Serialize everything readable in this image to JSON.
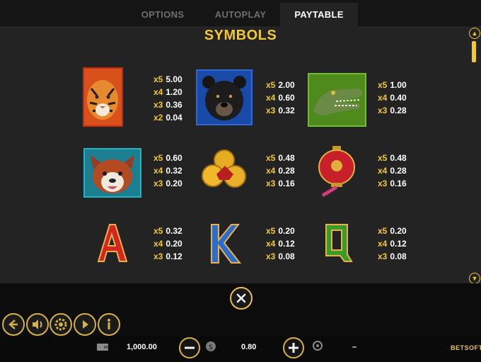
{
  "tabs": {
    "options": "OPTIONS",
    "autoplay": "AUTOPLAY",
    "paytable": "PAYTABLE"
  },
  "heading": "SYMBOLS",
  "symbols": [
    {
      "name": "tiger",
      "pays": [
        {
          "k": "x5",
          "v": "5.00"
        },
        {
          "k": "x4",
          "v": "1.20"
        },
        {
          "k": "x3",
          "v": "0.36"
        },
        {
          "k": "x2",
          "v": "0.04"
        }
      ]
    },
    {
      "name": "bear",
      "pays": [
        {
          "k": "x5",
          "v": "2.00"
        },
        {
          "k": "x4",
          "v": "0.60"
        },
        {
          "k": "x3",
          "v": "0.32"
        }
      ]
    },
    {
      "name": "crocodile",
      "pays": [
        {
          "k": "x5",
          "v": "1.00"
        },
        {
          "k": "x4",
          "v": "0.40"
        },
        {
          "k": "x3",
          "v": "0.28"
        }
      ]
    },
    {
      "name": "red-panda",
      "pays": [
        {
          "k": "x5",
          "v": "0.60"
        },
        {
          "k": "x4",
          "v": "0.32"
        },
        {
          "k": "x3",
          "v": "0.20"
        }
      ]
    },
    {
      "name": "coins",
      "pays": [
        {
          "k": "x5",
          "v": "0.48"
        },
        {
          "k": "x4",
          "v": "0.28"
        },
        {
          "k": "x3",
          "v": "0.16"
        }
      ]
    },
    {
      "name": "lantern",
      "pays": [
        {
          "k": "x5",
          "v": "0.48"
        },
        {
          "k": "x4",
          "v": "0.28"
        },
        {
          "k": "x3",
          "v": "0.16"
        }
      ]
    },
    {
      "name": "A",
      "letter": "A",
      "pays": [
        {
          "k": "x5",
          "v": "0.32"
        },
        {
          "k": "x4",
          "v": "0.20"
        },
        {
          "k": "x3",
          "v": "0.12"
        }
      ]
    },
    {
      "name": "K",
      "letter": "K",
      "pays": [
        {
          "k": "x5",
          "v": "0.20"
        },
        {
          "k": "x4",
          "v": "0.12"
        },
        {
          "k": "x3",
          "v": "0.08"
        }
      ]
    },
    {
      "name": "Q",
      "letter": "Q",
      "pays": [
        {
          "k": "x5",
          "v": "0.20"
        },
        {
          "k": "x4",
          "v": "0.12"
        },
        {
          "k": "x3",
          "v": "0.08"
        }
      ]
    }
  ],
  "footer": {
    "balance": "1,000.00",
    "bet": "0.80",
    "win": "–",
    "logo": "BETSOFT"
  },
  "colors": {
    "accent": "#f4c832",
    "panel": "#232323",
    "footer": "#0c0c0c"
  },
  "icons": [
    "back-icon",
    "sound-icon",
    "settings-icon",
    "autoplay-icon",
    "info-icon",
    "wallet-icon",
    "minus-icon",
    "coins-stack-icon",
    "plus-icon",
    "award-icon",
    "close-icon",
    "scroll-up-icon",
    "scroll-down-icon"
  ]
}
